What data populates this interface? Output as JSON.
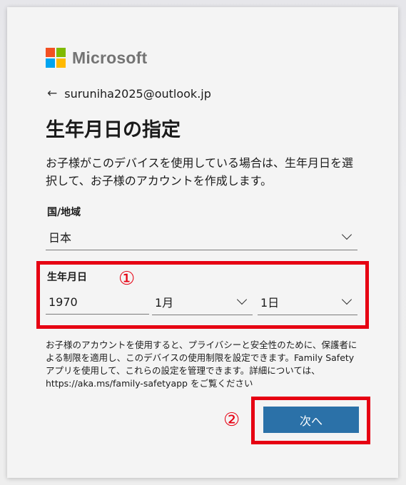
{
  "brand": {
    "name": "Microsoft",
    "logo_colors": [
      "#f25022",
      "#7fba00",
      "#00a4ef",
      "#ffb900"
    ]
  },
  "account": {
    "back_icon": "arrow-left-icon",
    "email": "suruniha2025@outlook.jp"
  },
  "page": {
    "title": "生年月日の指定",
    "description": "お子様がこのデバイスを使用している場合は、生年月日を選択して、お子様のアカウントを作成します。"
  },
  "country": {
    "label": "国/地域",
    "selected": "日本"
  },
  "birthdate": {
    "label": "生年月日",
    "year_value": "1970",
    "month_selected": "1月",
    "day_selected": "1日"
  },
  "note": {
    "text": "お子様のアカウントを使用すると、プライバシーと安全性のために、保護者による制限を適用し、このデバイスの使用制限を設定できます。Family Safety アプリを使用して、これらの設定を管理できます。詳細については、https://aka.ms/family-safetyapp をご覧ください"
  },
  "actions": {
    "next_label": "次へ"
  },
  "annotations": {
    "marker_1": "①",
    "marker_2": "②",
    "highlight_color": "#e60012"
  }
}
